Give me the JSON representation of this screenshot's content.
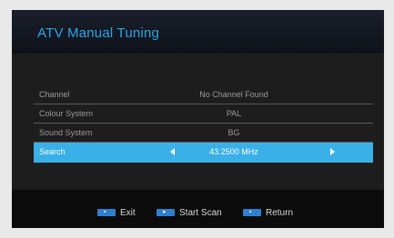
{
  "title": "ATV Manual Tuning",
  "rows": [
    {
      "label": "Channel",
      "value": "No Channel Found"
    },
    {
      "label": "Colour System",
      "value": "PAL"
    },
    {
      "label": "Sound System",
      "value": "BG"
    },
    {
      "label": "Search",
      "value": "43.2500 MHz"
    }
  ],
  "footer": {
    "exit": "Exit",
    "start_scan": "Start Scan",
    "return": "Return"
  },
  "colors": {
    "title": "#2aa6e8",
    "highlight": "#3ab0e8",
    "key": "#2f7fd0"
  }
}
